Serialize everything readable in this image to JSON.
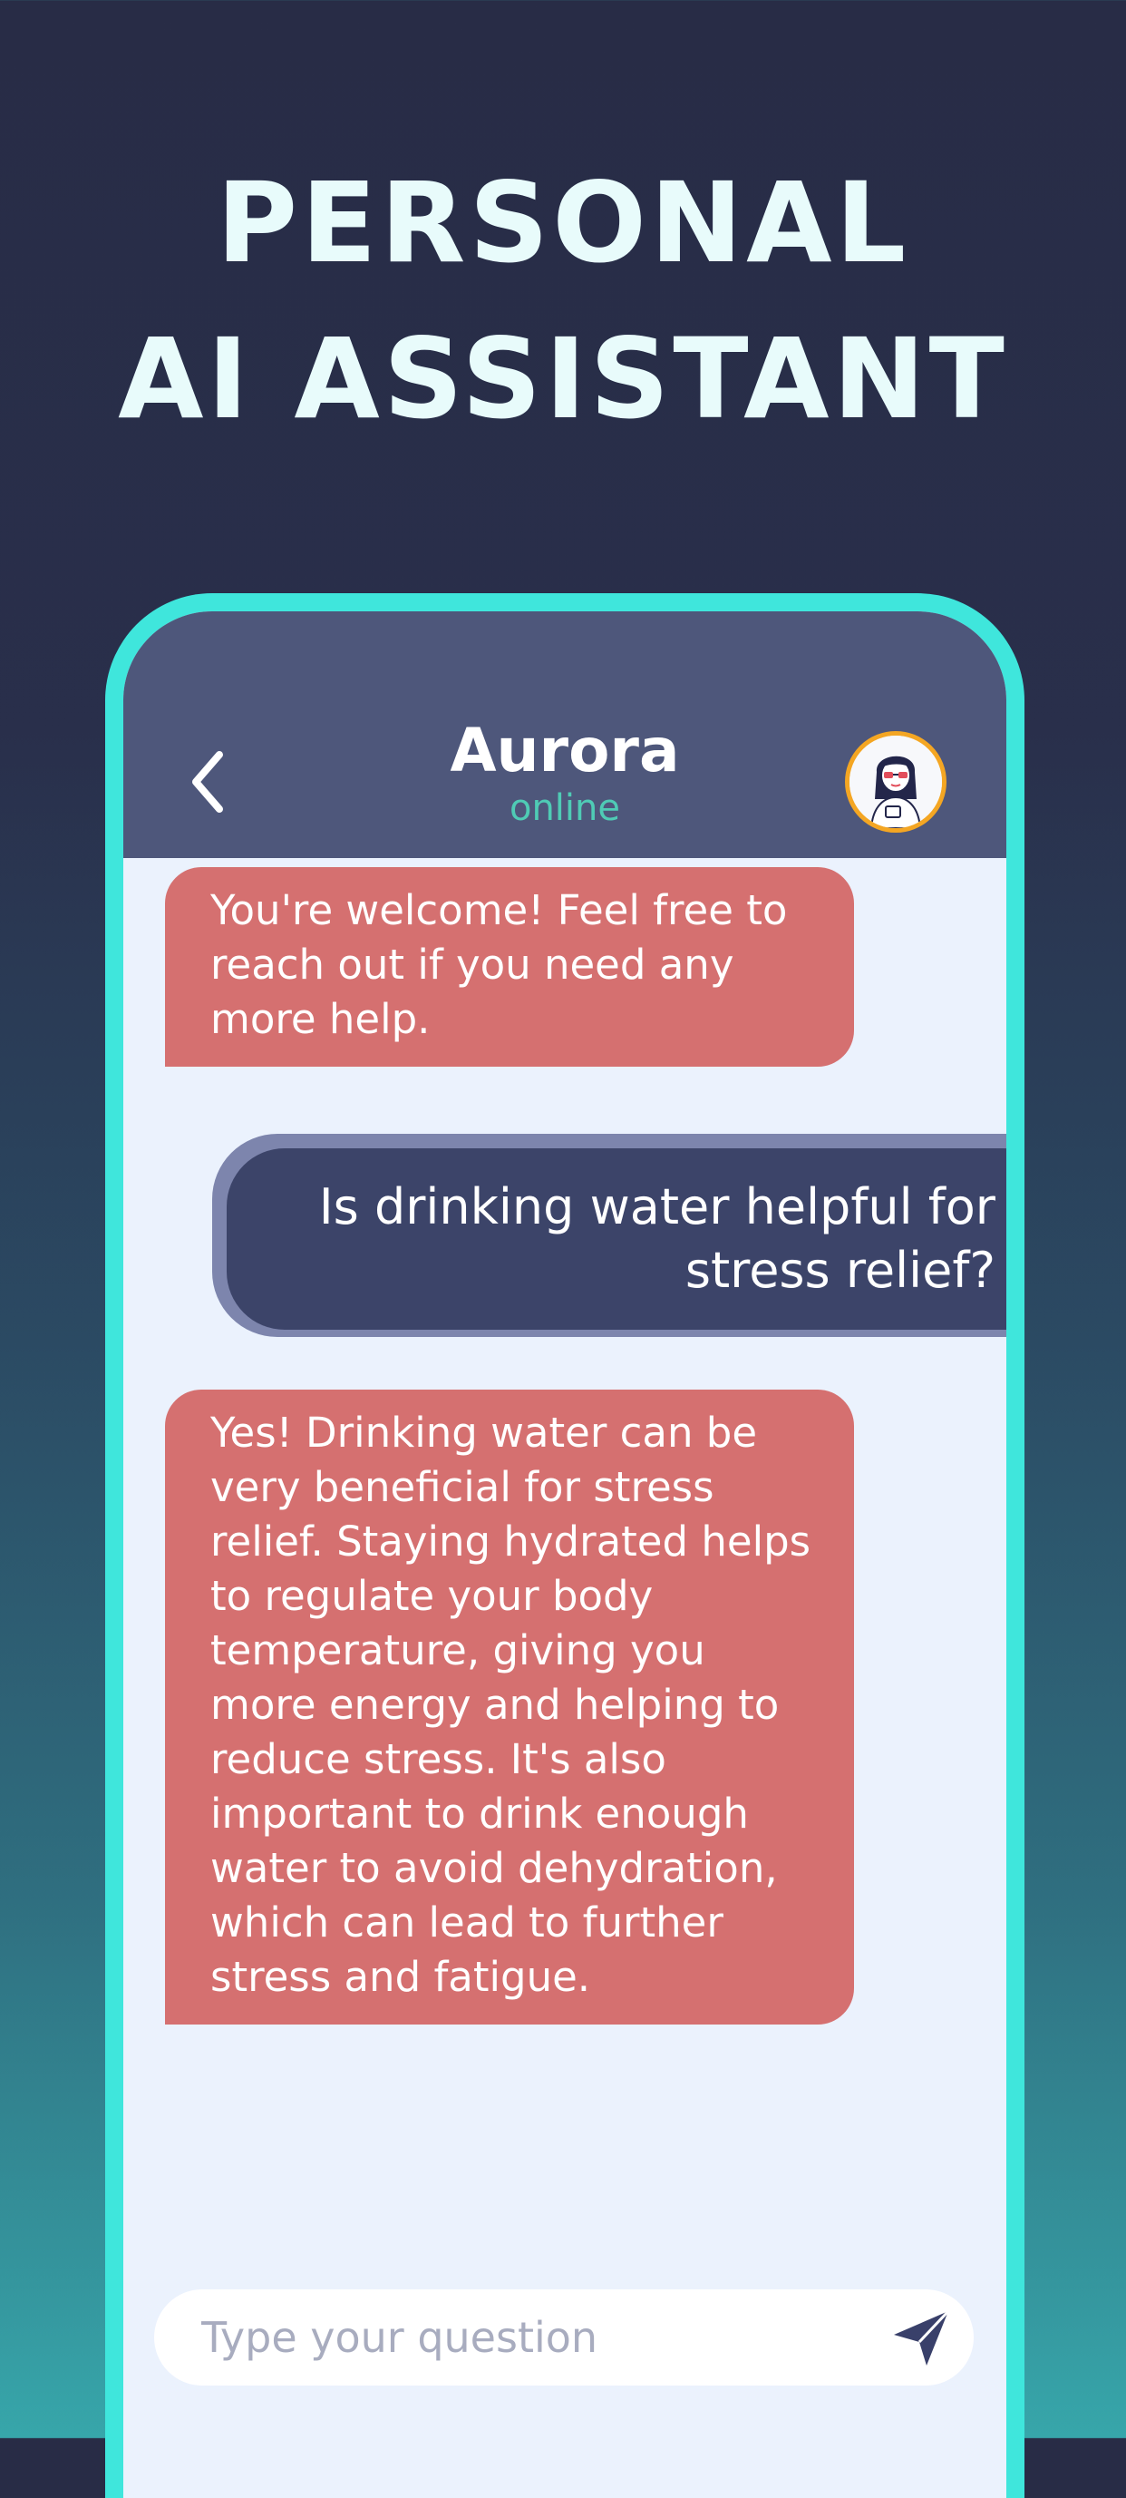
{
  "headline": {
    "line1": "PERSONAL",
    "line2": "AI ASSISTANT"
  },
  "chat_header": {
    "contact_name": "Aurora",
    "status": "online",
    "back_icon": "chevron-left-icon",
    "avatar": "assistant-avatar"
  },
  "messages": [
    {
      "sender": "assistant",
      "text": "You're welcome! Feel free to reach out if you need any more help."
    },
    {
      "sender": "user",
      "text": "Is drinking water helpful for stress relief?"
    },
    {
      "sender": "assistant",
      "text": "Yes! Drinking water can be very beneficial for stress relief. Staying hydrated helps to regulate your body temperature, giving you more energy and helping to reduce stress. It's also important to drink enough water to avoid dehydration, which can lead to further stress and fatigue."
    }
  ],
  "composer": {
    "placeholder": "Type your question",
    "value": "",
    "send_icon": "send-icon"
  },
  "colors": {
    "phone_frame": "#3fe6dc",
    "header_bg": "#4e577b",
    "status_text": "#4fcbb5",
    "assistant_bubble": "#d57070",
    "user_bubble": "#3c4469",
    "user_bubble_border": "#7d85ad",
    "chat_bg": "#ebf2fd",
    "avatar_ring": "#f4a623"
  }
}
